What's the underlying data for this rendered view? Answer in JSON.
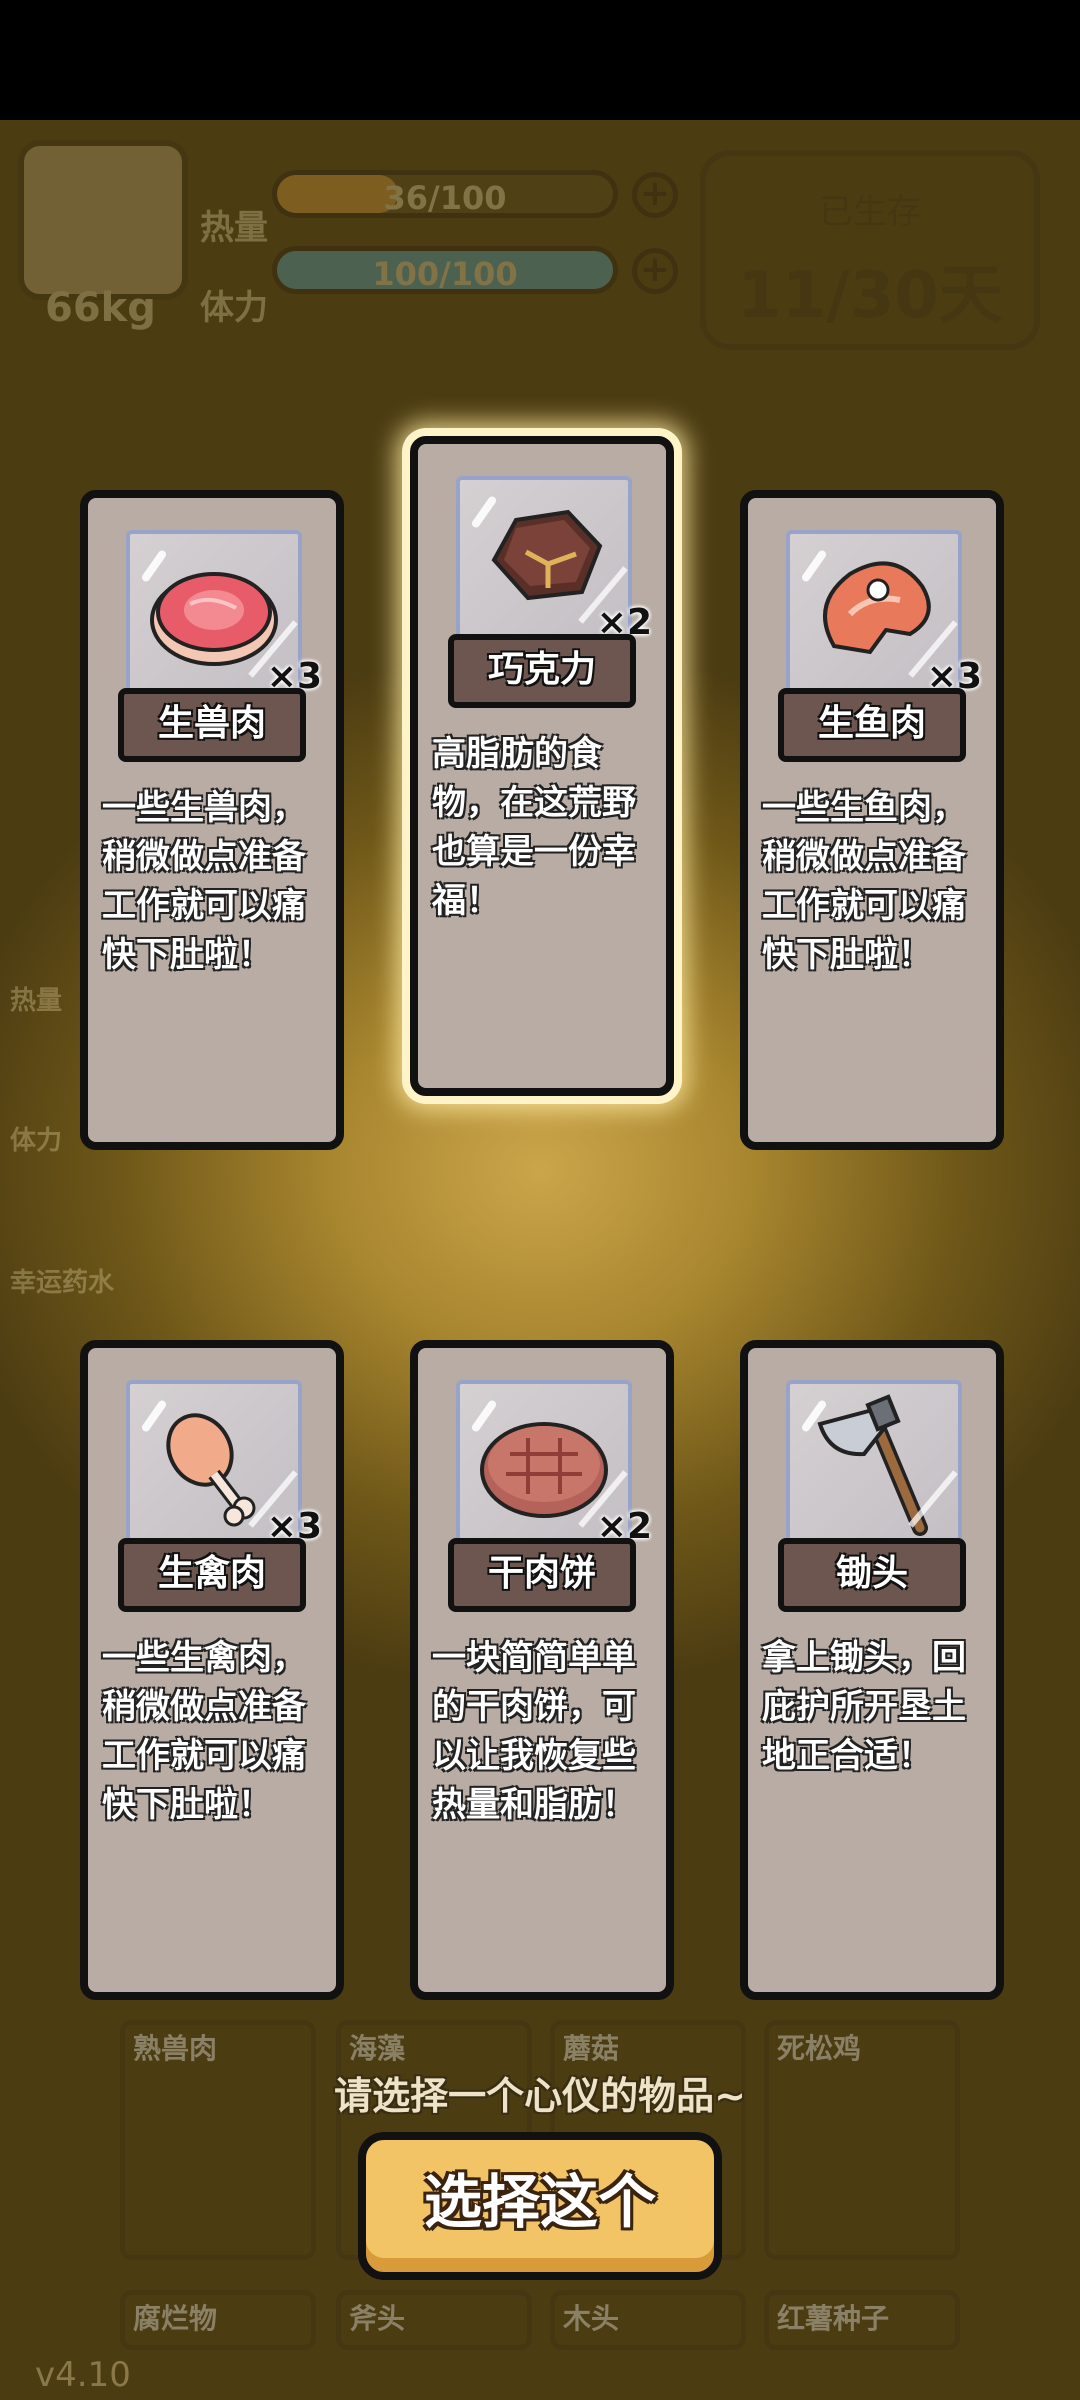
{
  "hud": {
    "weight": "66kg",
    "heat_label": "热量",
    "stamina_label": "体力",
    "heat_value": "36/100",
    "heat_fraction": 0.36,
    "stamina_value": "100/100",
    "stamina_fraction": 1.0,
    "survived_label": "已生存",
    "survived_days": "11/30天"
  },
  "side_items": [
    "热量",
    "体力",
    "幸运药水"
  ],
  "cards": [
    {
      "name": "生兽肉",
      "qty": "×3",
      "desc": "一些生兽肉，稍微做点准备工作就可以痛快下肚啦！",
      "icon": "raw-meat-icon"
    },
    {
      "name": "巧克力",
      "qty": "×2",
      "desc": "高脂肪的食物，在这荒野也算是一份幸福！",
      "icon": "chocolate-icon"
    },
    {
      "name": "生鱼肉",
      "qty": "×3",
      "desc": "一些生鱼肉，稍微做点准备工作就可以痛快下肚啦！",
      "icon": "raw-fish-icon"
    },
    {
      "name": "生禽肉",
      "qty": "×3",
      "desc": "一些生禽肉，稍微做点准备工作就可以痛快下肚啦！",
      "icon": "raw-poultry-icon"
    },
    {
      "name": "干肉饼",
      "qty": "×2",
      "desc": "一块简简单单的干肉饼，可以让我恢复些热量和脂肪！",
      "icon": "jerky-patty-icon"
    },
    {
      "name": "锄头",
      "qty": "",
      "desc": "拿上锄头，回庇护所开垦土地正合适！",
      "icon": "hoe-icon"
    }
  ],
  "inventory": [
    "熟兽肉",
    "海藻",
    "蘑菇",
    "死松鸡"
  ],
  "inventory_row2": [
    "腐烂物",
    "斧头",
    "木头",
    "红薯种子"
  ],
  "prompt": "请选择一个心仪的物品~",
  "select_button": "选择这个",
  "version": "v4.10"
}
